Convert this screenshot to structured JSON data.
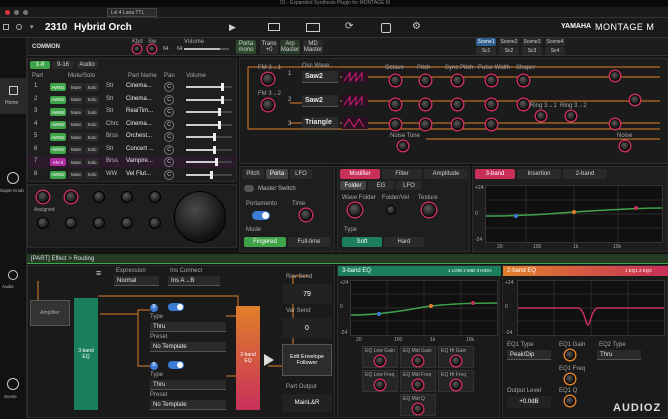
{
  "window": {
    "title": "01 - Expanded Synthesis Plugin for MONTAGE M",
    "mac_label": "Lvl 4 Lana TTL"
  },
  "header": {
    "perf_number": "2310",
    "perf_name": "Hybrid Orch",
    "brand": "YAMAHA",
    "product": "MONTAGE M",
    "scene_labels": [
      "Scene1",
      "Scene2",
      "Scene3",
      "Scene4"
    ],
    "scene_labels_short": [
      "Sc1",
      "Sc2",
      "Sc3",
      "Sc4"
    ]
  },
  "common": {
    "label": "COMMON",
    "kbd": "Kbd",
    "sw": "Sw",
    "volume_label": "Volume",
    "porta_label": "Porta",
    "porta_val": "mono",
    "transpose_label": "Trans",
    "transpose_val": "+0",
    "arp_label": "Arp",
    "arp_val": "Master",
    "md_label": "MD",
    "md_val": "Master",
    "val1": "64",
    "val2": "64"
  },
  "side_nav": {
    "home": "Home",
    "super_knob": "Super Knob",
    "audio": "Audio",
    "scene": "Scene"
  },
  "part_tabs": [
    "1-8",
    "9-16",
    "Audio"
  ],
  "part_table": {
    "headers": [
      "Part",
      "Mute/Solo",
      "Part Name",
      "Pan",
      "Volume"
    ],
    "rows": [
      {
        "num": "1",
        "type": "AWM2",
        "cat": "Str",
        "name": "Cinema...",
        "pan": "C",
        "vol": 0.78
      },
      {
        "num": "2",
        "type": "AWM2",
        "cat": "Str",
        "name": "Cinema...",
        "pan": "C",
        "vol": 0.78
      },
      {
        "num": "3",
        "type": "AWM2",
        "cat": "Str",
        "name": "RealTim...",
        "pan": "C",
        "vol": 0.72
      },
      {
        "num": "4",
        "type": "AWM2",
        "cat": "Chrc",
        "name": "Cinema...",
        "pan": "C",
        "vol": 0.72
      },
      {
        "num": "5",
        "type": "AWM2",
        "cat": "Brss",
        "name": "Orchest...",
        "pan": "C",
        "vol": 0.6
      },
      {
        "num": "6",
        "type": "AWM2",
        "cat": "Str",
        "name": "Concert ...",
        "pan": "C",
        "vol": 0.6
      },
      {
        "num": "7",
        "type": "AN-X",
        "cat": "Brss",
        "name": "Vampire...",
        "pan": "C",
        "vol": 0.65
      },
      {
        "num": "8",
        "type": "AWM2",
        "cat": "WW",
        "name": "Vel Flut...",
        "pan": "C",
        "vol": 0.55
      }
    ],
    "mute": "Mute",
    "solo": "Solo"
  },
  "knob_bank": {
    "assigned_label": "Assigned"
  },
  "osc": {
    "fm1": "FM 3→1",
    "fm2": "FM 3→2",
    "osc_wave_label": "Osc Wave",
    "waves": [
      "Saw2",
      "Saw2",
      "Triangle"
    ],
    "octave": "Octave",
    "pitch": "Pitch",
    "sync_pitch": "Sync Pitch",
    "pulse_width": "Pulse Width",
    "shaper": "Shaper",
    "ring1": "Ring 3→1",
    "ring2": "Ring 3→2",
    "noise_tone": "Noise Tone",
    "noise": "Noise",
    "rows": [
      "1",
      "2",
      "3"
    ]
  },
  "pitch_tabs": [
    "Pitch",
    "Porta",
    "LFO"
  ],
  "porta": {
    "master_switch": "Master Switch",
    "portamento": "Portamento",
    "time": "Time",
    "mode": "Mode",
    "mode_opts": [
      "Fingered",
      "Full-time"
    ]
  },
  "mod_tabs": [
    "Modifier",
    "Filter",
    "Amplitude"
  ],
  "mod_sub_tabs": [
    "Folder",
    "EG",
    "LFO"
  ],
  "folder": {
    "wave_folder": "Wave Folder",
    "folder_vel": "Folder/Vel",
    "texture": "Texture",
    "type": "Type",
    "type_opts": [
      "Soft",
      "Hard"
    ]
  },
  "eq3_tabs": [
    "3-band",
    "Insertion",
    "2-band"
  ],
  "eq_axis": {
    "db_ticks": [
      "+24",
      "+12",
      "0",
      "-12",
      "-24"
    ],
    "hz_ticks": [
      "20",
      "100",
      "1k",
      "10k"
    ]
  },
  "routing": {
    "title": "[PART] Effect > Routing",
    "expression": "Expression",
    "expression_val": "Normal",
    "ins_connect": "Ins Connect",
    "ins_connect_val": "Ins A→B",
    "amplifier": "Amplifier",
    "eq3": "3-band EQ",
    "eq2": "2-band EQ",
    "type": "Type",
    "preset": "Preset",
    "a_type": "Thru",
    "a_preset": "No Template",
    "b_type": "Thru",
    "b_preset": "No Template",
    "ins_a": "A",
    "ins_b": "B",
    "rev_send": "Rev Send",
    "rev_val": "79",
    "var_send": "Var Send",
    "var_val": "0",
    "edit_env": "Edit Envelope Follower",
    "part_output": "Part Output",
    "part_output_val": "MainL&R"
  },
  "eq3": {
    "title": "3-band EQ",
    "ch": "1 LOW 2 MID 3 HIGH",
    "low_gain": "EQ Low Gain",
    "mid_gain": "EQ Mid Gain",
    "high_gain": "EQ Hi Gain",
    "low_freq": "EQ Low Freq",
    "mid_freq": "EQ Mid Freq",
    "high_freq": "EQ Hi Freq",
    "mid_q": "EQ Mid Q"
  },
  "eq2": {
    "title": "2-band EQ",
    "ch": "1 EQ1 2 EQ2",
    "eq1_type": "EQ1 Type",
    "eq1_type_val": "Peak/Dip",
    "eq1_gain": "EQ1 Gain",
    "eq2_type": "EQ2 Type",
    "eq2_type_val": "Thru",
    "eq1_freq": "EQ1 Freq",
    "output_level": "Output Level",
    "output_val": "+0.0dB",
    "eq1_q": "EQ1 Q"
  },
  "watermark": "AUDIOZ",
  "colors": {
    "accent_red": "#c8305a",
    "accent_orange": "#e0802a",
    "green": "#3fa34a",
    "blue": "#3b7bd4",
    "magenta": "#d4207a",
    "teal": "#1a7f5a"
  }
}
